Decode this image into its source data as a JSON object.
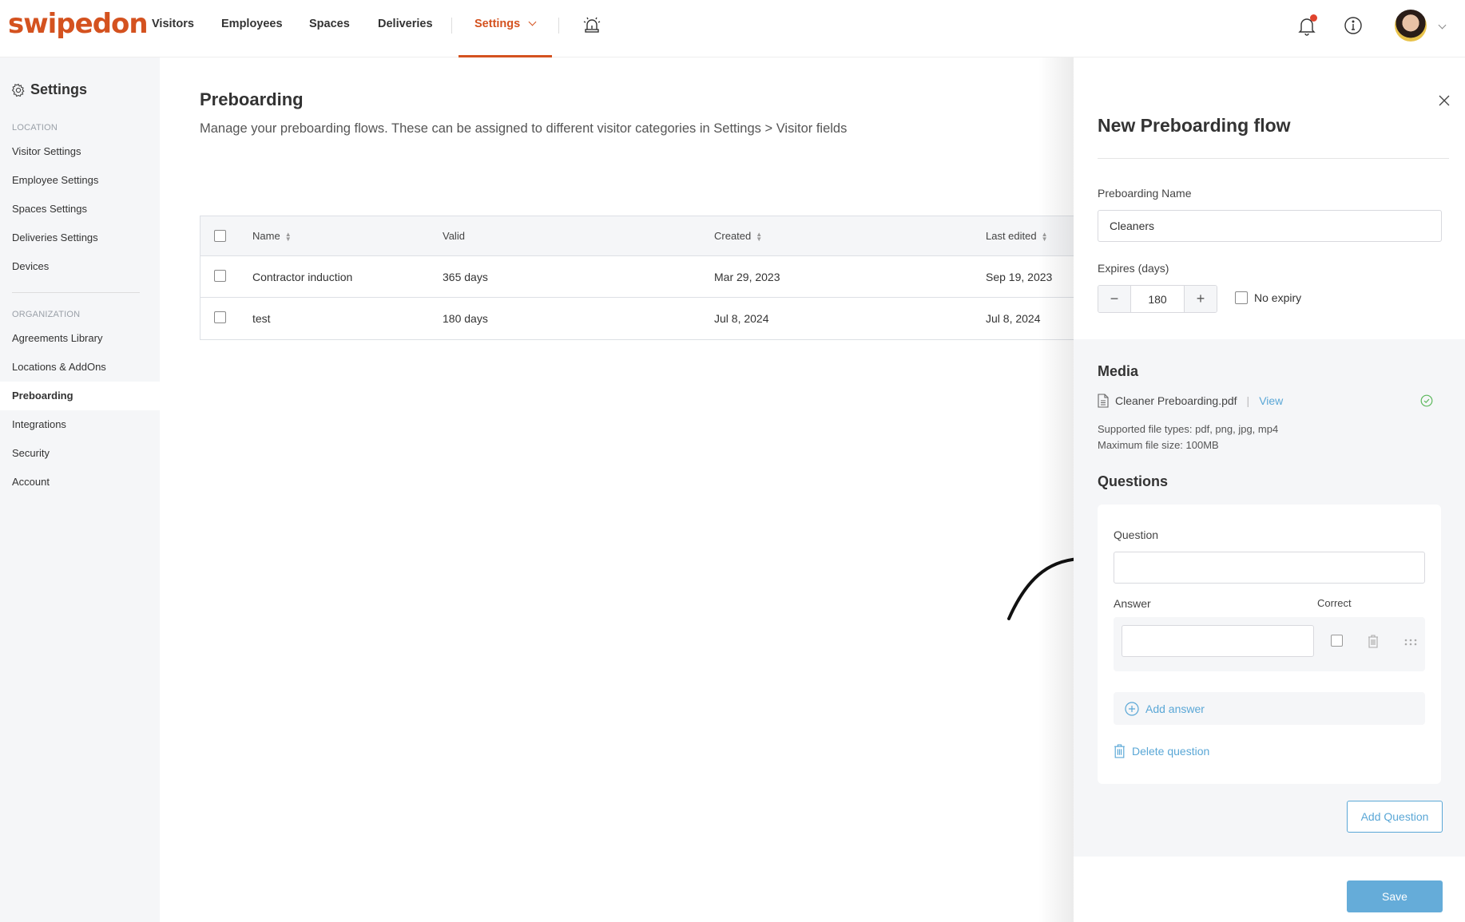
{
  "header": {
    "logo": "swipedon",
    "nav": [
      "Visitors",
      "Employees",
      "Spaces",
      "Deliveries"
    ],
    "active_nav": "Settings",
    "icons": [
      "emergency-alarm-icon",
      "bell-icon",
      "info-icon",
      "avatar",
      "chevron-down-icon"
    ],
    "brand_color": "#d4521f"
  },
  "sidebar": {
    "title": "Settings",
    "location_heading": "LOCATION",
    "location_items": [
      "Visitor Settings",
      "Employee Settings",
      "Spaces Settings",
      "Deliveries Settings",
      "Devices"
    ],
    "organization_heading": "ORGANIZATION",
    "organization_items": [
      "Agreements Library",
      "Locations & AddOns",
      "Preboarding",
      "Integrations",
      "Security",
      "Account"
    ],
    "active_item": "Preboarding"
  },
  "main": {
    "title": "Preboarding",
    "description": "Manage your preboarding flows. These can be assigned to different visitor categories in Settings > Visitor fields",
    "table": {
      "columns": [
        "Name",
        "Valid",
        "Created",
        "Last edited"
      ],
      "rows": [
        {
          "name": "Contractor induction",
          "valid": "365 days",
          "created": "Mar 29, 2023",
          "last_edited": "Sep 19, 2023"
        },
        {
          "name": "test",
          "valid": "180 days",
          "created": "Jul 8, 2024",
          "last_edited": "Jul 8, 2024"
        }
      ]
    }
  },
  "panel": {
    "title": "New Preboarding flow",
    "name_label": "Preboarding Name",
    "name_value": "Cleaners",
    "expires_label": "Expires (days)",
    "expires_value": "180",
    "decrement": "−",
    "increment": "+",
    "no_expiry_label": "No expiry",
    "media_title": "Media",
    "file_name": "Cleaner Preboarding.pdf",
    "view_link": "View",
    "supported_types": "Supported file types: pdf, png, jpg, mp4",
    "max_size": "Maximum file size: 100MB",
    "questions_title": "Questions",
    "question_label": "Question",
    "question_value": "",
    "answer_label": "Answer",
    "correct_label": "Correct",
    "answer_value": "",
    "add_answer": "Add answer",
    "delete_question": "Delete question",
    "add_question": "Add Question",
    "save": "Save",
    "accent_color": "#5aa7d6",
    "success_color": "#5cb85c"
  }
}
